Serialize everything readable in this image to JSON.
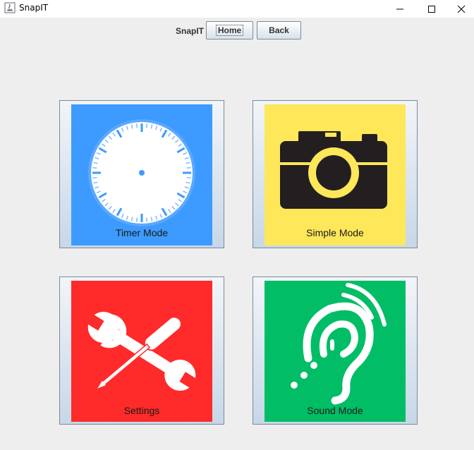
{
  "window": {
    "title": "SnapIT",
    "app_icon": "java-icon",
    "controls": [
      "minimize-icon",
      "maximize-icon",
      "close-icon"
    ]
  },
  "toolbar": {
    "label": "SnapIT",
    "home_label": "Home",
    "back_label": "Back"
  },
  "tiles": [
    {
      "label": "Timer Mode",
      "icon": "clock-icon",
      "color": "#3d9bff"
    },
    {
      "label": "Simple Mode",
      "icon": "camera-icon",
      "color": "#ffe75a"
    },
    {
      "label": "Settings",
      "icon": "tools-icon",
      "color": "#ff2a2a"
    },
    {
      "label": "Sound Mode",
      "icon": "hearing-icon",
      "color": "#00bd66"
    }
  ]
}
